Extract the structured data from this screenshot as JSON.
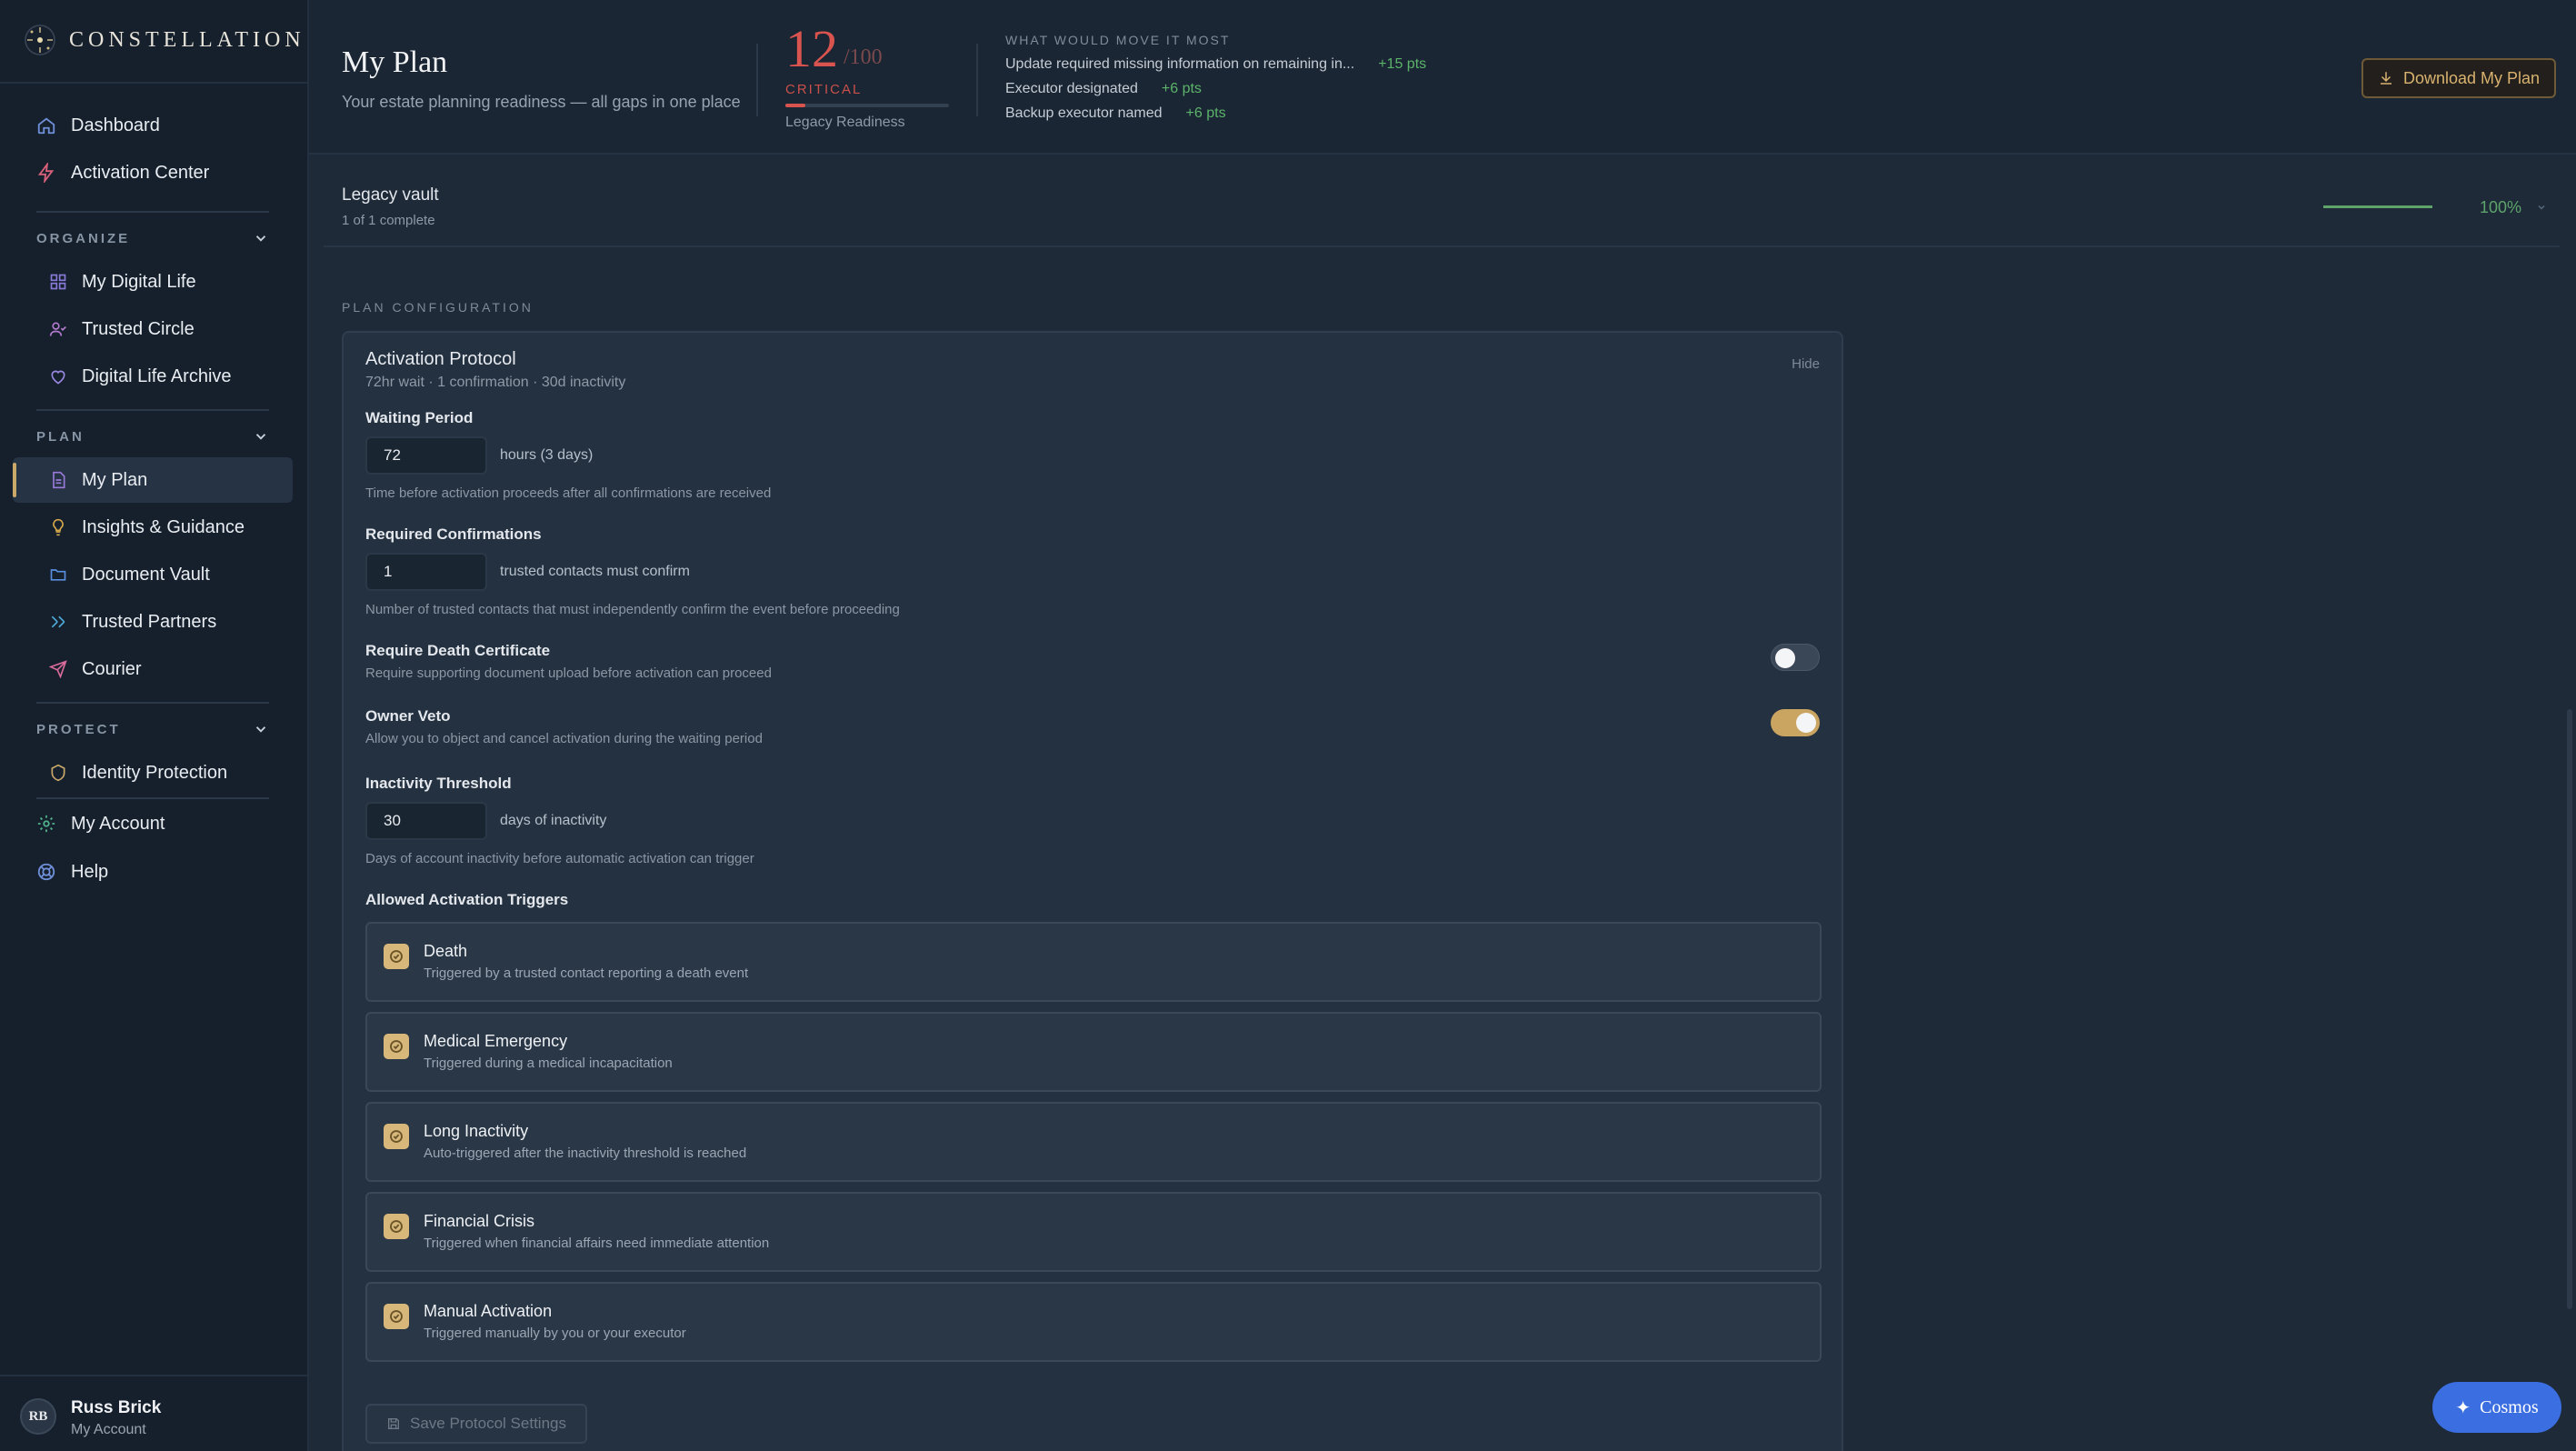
{
  "brand": {
    "name": "CONSTELLATION"
  },
  "sidebar": {
    "top_items": [
      {
        "label": "Dashboard",
        "icon": "home-icon"
      },
      {
        "label": "Activation Center",
        "icon": "bolt-icon"
      }
    ],
    "sections": [
      {
        "title": "ORGANIZE",
        "items": [
          {
            "label": "My Digital Life",
            "icon": "grid-icon"
          },
          {
            "label": "Trusted Circle",
            "icon": "user-check-icon"
          },
          {
            "label": "Digital Life Archive",
            "icon": "heart-icon"
          }
        ]
      },
      {
        "title": "PLAN",
        "items": [
          {
            "label": "My Plan",
            "icon": "document-icon",
            "active": true
          },
          {
            "label": "Insights & Guidance",
            "icon": "lightbulb-icon"
          },
          {
            "label": "Document Vault",
            "icon": "folder-icon"
          },
          {
            "label": "Trusted Partners",
            "icon": "handshake-icon"
          },
          {
            "label": "Courier",
            "icon": "send-icon"
          }
        ]
      },
      {
        "title": "PROTECT",
        "items": [
          {
            "label": "Identity Protection",
            "icon": "shield-icon"
          }
        ]
      }
    ],
    "bottom_items": [
      {
        "label": "My Account",
        "icon": "gear-icon"
      },
      {
        "label": "Help",
        "icon": "lifebuoy-icon"
      }
    ],
    "user": {
      "initials": "RB",
      "name": "Russ Brick",
      "subtitle": "My Account"
    }
  },
  "header": {
    "title": "My Plan",
    "subtitle": "Your estate planning readiness — all gaps in one place",
    "score": {
      "value": "12",
      "denominator": "/100",
      "status": "CRITICAL",
      "label": "Legacy Readiness",
      "fraction": 0.12
    },
    "move": {
      "heading": "WHAT WOULD MOVE IT MOST",
      "items": [
        {
          "text": "Update required missing information on remaining in...",
          "pts": "+15 pts"
        },
        {
          "text": "Executor designated",
          "pts": "+6 pts"
        },
        {
          "text": "Backup executor named",
          "pts": "+6 pts"
        }
      ]
    },
    "download_label": "Download My Plan"
  },
  "legacy": {
    "title": "Legacy vault",
    "subtitle": "1 of 1 complete",
    "percent": "100%",
    "fraction": 1.0
  },
  "config": {
    "heading": "PLAN CONFIGURATION",
    "card": {
      "title": "Activation Protocol",
      "subtitle": "72hr wait · 1 confirmation · 30d inactivity",
      "hide_label": "Hide",
      "waiting": {
        "label": "Waiting Period",
        "value": "72",
        "unit": "hours (3 days)",
        "help": "Time before activation proceeds after all confirmations are received"
      },
      "confirmations": {
        "label": "Required Confirmations",
        "value": "1",
        "unit": "trusted contacts must confirm",
        "help": "Number of trusted contacts that must independently confirm the event before proceeding"
      },
      "death_cert": {
        "label": "Require Death Certificate",
        "help": "Require supporting document upload before activation can proceed",
        "enabled": false
      },
      "veto": {
        "label": "Owner Veto",
        "help": "Allow you to object and cancel activation during the waiting period",
        "enabled": true
      },
      "inactivity": {
        "label": "Inactivity Threshold",
        "value": "30",
        "unit": "days of inactivity",
        "help": "Days of account inactivity before automatic activation can trigger"
      },
      "triggers_label": "Allowed Activation Triggers",
      "triggers": [
        {
          "name": "Death",
          "desc": "Triggered by a trusted contact reporting a death event"
        },
        {
          "name": "Medical Emergency",
          "desc": "Triggered during a medical incapacitation"
        },
        {
          "name": "Long Inactivity",
          "desc": "Auto-triggered after the inactivity threshold is reached"
        },
        {
          "name": "Financial Crisis",
          "desc": "Triggered when financial affairs need immediate attention"
        },
        {
          "name": "Manual Activation",
          "desc": "Triggered manually by you or your executor"
        }
      ],
      "save_label": "Save Protocol Settings"
    }
  },
  "cosmos_label": "Cosmos",
  "colors": {
    "accent_gold": "#c9a86a",
    "critical_red": "#d9534f",
    "success_green": "#5cb36a",
    "cosmos_blue": "#3b6ee0"
  }
}
